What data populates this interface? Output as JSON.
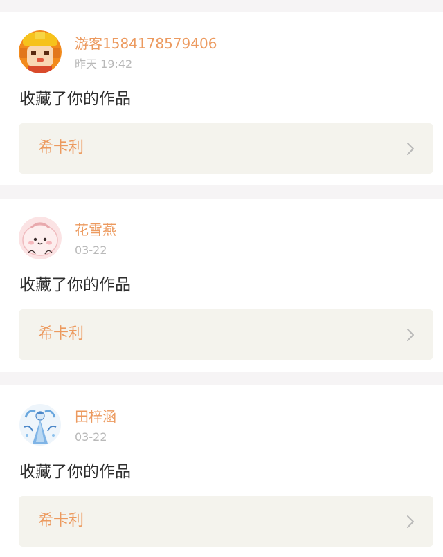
{
  "notifications": [
    {
      "username": "游客1584178579406",
      "timestamp": "昨天 19:42",
      "action": "收藏了你的作品",
      "work_title": "希卡利",
      "avatar_icon": "monkey-king-avatar-icon"
    },
    {
      "username": "花雪燕",
      "timestamp": "03-22",
      "action": "收藏了你的作品",
      "work_title": "希卡利",
      "avatar_icon": "pink-blob-avatar-icon"
    },
    {
      "username": "田梓涵",
      "timestamp": "03-22",
      "action": "收藏了你的作品",
      "work_title": "希卡利",
      "avatar_icon": "blue-figure-avatar-icon"
    }
  ],
  "colors": {
    "accent": "#ec9a5f",
    "timestamp": "#b9b9b9",
    "link_background": "#f4f3ed",
    "page_background": "#f6f4f5"
  }
}
